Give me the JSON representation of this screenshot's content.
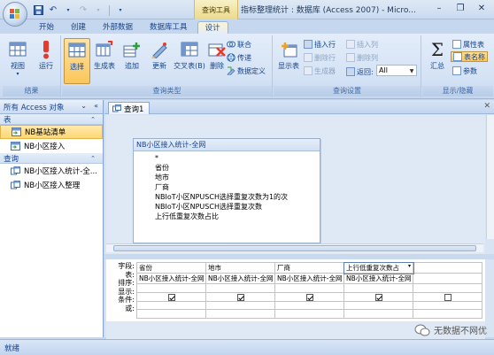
{
  "window": {
    "title": "指标整理统计 : 数据库 (Access 2007) - Micro...",
    "context_tab_group": "查询工具"
  },
  "ribbon_tabs": [
    "开始",
    "创建",
    "外部数据",
    "数据库工具",
    "设计"
  ],
  "ribbon": {
    "results": {
      "label": "结果",
      "view": "视图",
      "run": "运行"
    },
    "query_type": {
      "label": "查询类型",
      "select": "选择",
      "make_table": "生成表",
      "append": "追加",
      "update": "更新",
      "crosstab": "交叉表(B)",
      "delete": "删除",
      "union": "联合",
      "pass_through": "传递",
      "data_definition": "数据定义"
    },
    "query_setup": {
      "label": "查询设置",
      "show_table": "显示表",
      "insert_rows": "插入行",
      "delete_rows": "删除行",
      "builder": "生成器",
      "insert_columns": "插入列",
      "delete_columns": "删除列",
      "return": "返回:",
      "return_value": "All"
    },
    "show_hide": {
      "label": "显示/隐藏",
      "totals": "汇总",
      "property_sheet": "属性表",
      "table_names": "表名称",
      "parameters": "参数"
    }
  },
  "nav": {
    "header": "所有 Access 对象",
    "groups": [
      {
        "label": "表",
        "items": [
          {
            "label": "NB基站清单",
            "selected": true
          },
          {
            "label": "NB小区接入",
            "selected": false
          }
        ]
      },
      {
        "label": "查询",
        "items": [
          {
            "label": "NB小区接入统计-全...",
            "selected": false
          },
          {
            "label": "NB小区接入整理",
            "selected": false
          }
        ]
      }
    ]
  },
  "document": {
    "tab_label": "查询1",
    "table": {
      "title": "NB小区接入统计-全网",
      "fields": [
        "*",
        "省份",
        "地市",
        "厂商",
        "NBIoT小区NPUSCH选择重复次数为1的次",
        "NBIoT小区NPUSCH选择重复次数",
        "上行低重复次数占比"
      ]
    }
  },
  "grid": {
    "row_labels": [
      "字段:",
      "表:",
      "排序:",
      "显示:",
      "条件:",
      "或:"
    ],
    "columns": [
      {
        "field": "省份",
        "table": "NB小区接入统计-全网",
        "show": true
      },
      {
        "field": "地市",
        "table": "NB小区接入统计-全网",
        "show": true
      },
      {
        "field": "厂商",
        "table": "NB小区接入统计-全网",
        "show": true
      },
      {
        "field": "上行低重复次数占",
        "table": "NB小区接入统计-全网",
        "show": true
      },
      {
        "field": "",
        "table": "",
        "show": false
      }
    ]
  },
  "status": {
    "text": "就绪"
  },
  "watermark": {
    "text": "无数据不网优"
  }
}
